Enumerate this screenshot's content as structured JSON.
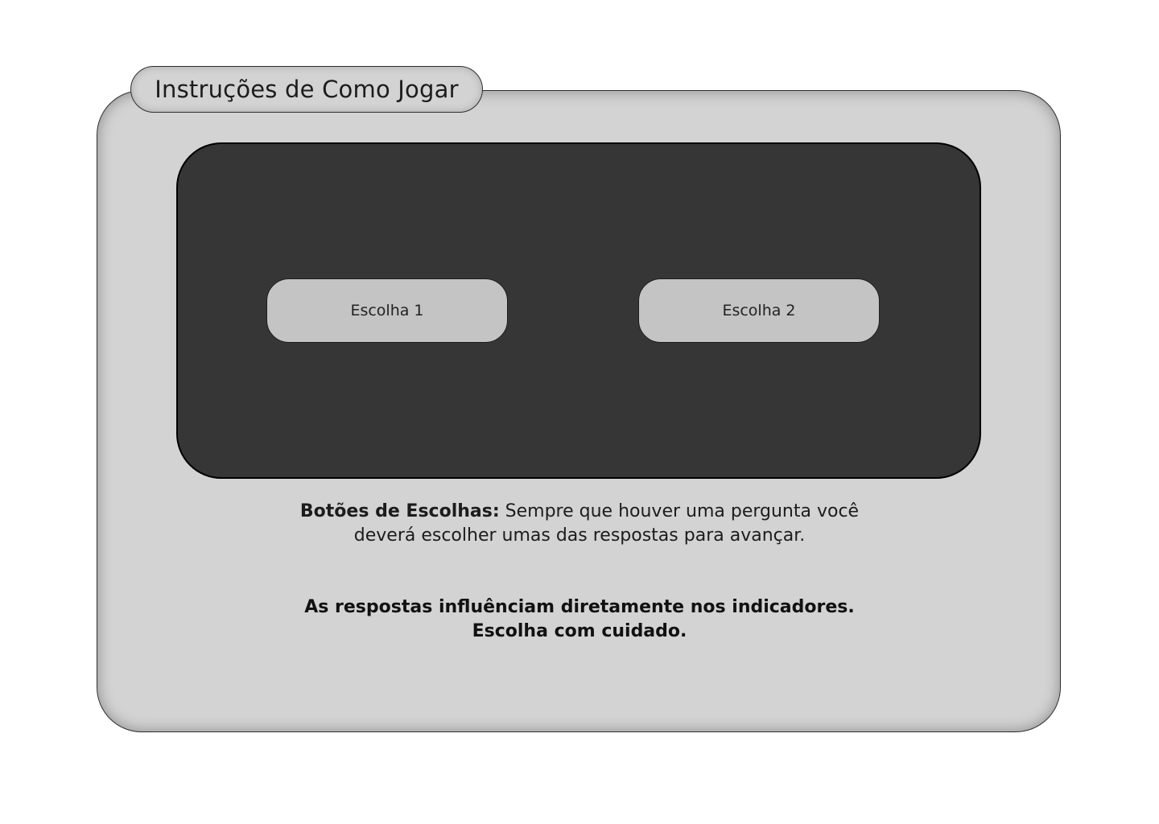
{
  "title": "Instruções de Como Jogar",
  "preview": {
    "choices": [
      {
        "label": "Escolha 1"
      },
      {
        "label": "Escolha 2"
      }
    ]
  },
  "description": {
    "heading": "Botões de Escolhas:",
    "text": "Sempre que houver uma pergunta você deverá escolher umas das respostas para avançar."
  },
  "warning": {
    "line1": "As respostas influênciam diretamente nos indicadores.",
    "line2": "Escolha com cuidado."
  },
  "colors": {
    "panel": "#d3d3d3",
    "preview": "#363636",
    "choice": "#c4c4c4"
  }
}
